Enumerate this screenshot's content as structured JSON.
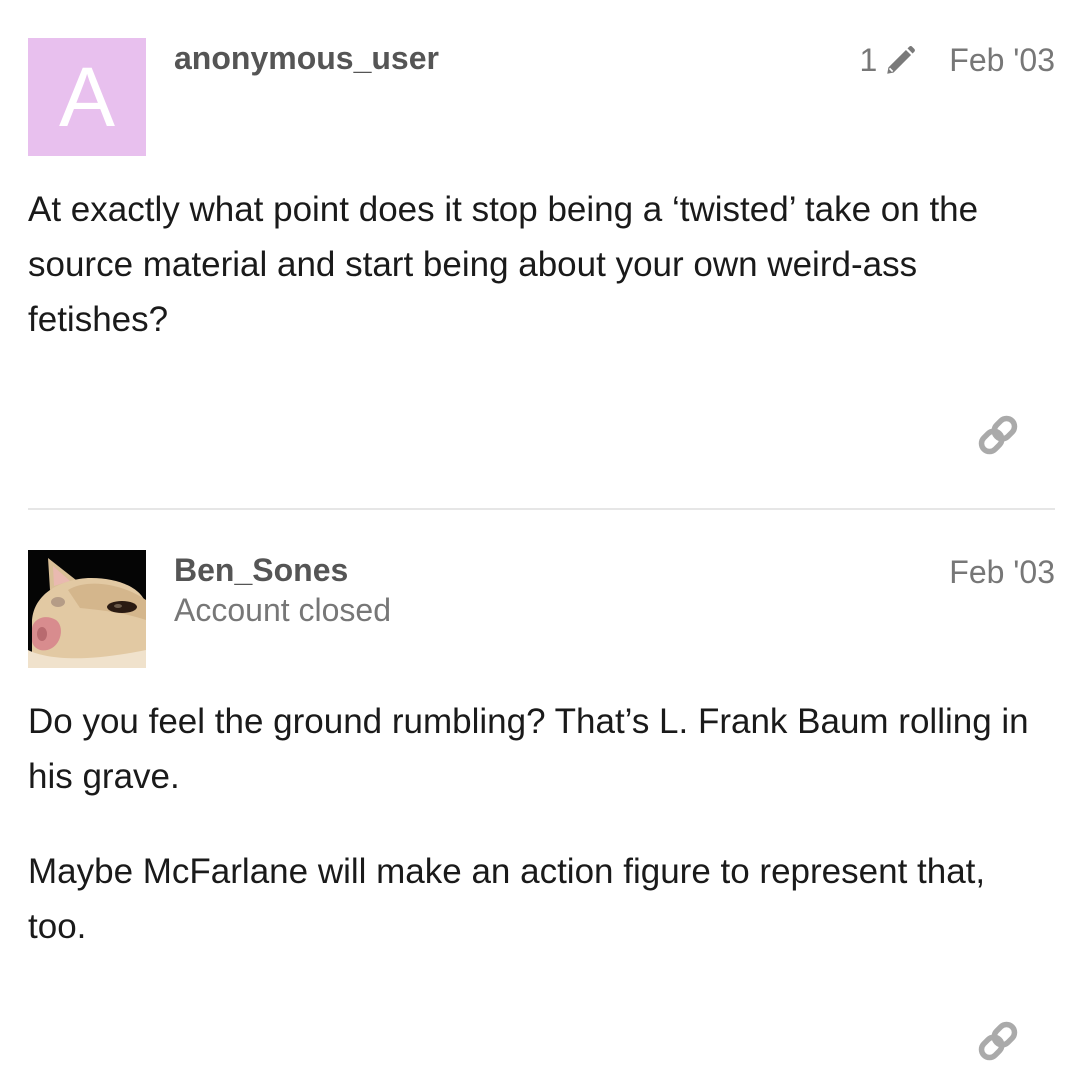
{
  "posts": [
    {
      "username": "anonymous_user",
      "avatar_letter": "A",
      "avatar_color": "#e8c0ee",
      "edit_count": "1",
      "date": "Feb '03",
      "paragraphs": [
        "At exactly what point does it stop being a ‘twisted’ take on the source material and start being about your own weird-ass fetishes?"
      ],
      "icons": {
        "edit": "pencil-icon",
        "share": "link-icon"
      }
    },
    {
      "username": "Ben_Sones",
      "status": "Account closed",
      "date": "Feb '03",
      "paragraphs": [
        "Do you feel the ground rumbling? That’s L. Frank Baum rolling in his grave.",
        "Maybe McFarlane will make an action figure to represent that, too."
      ],
      "icons": {
        "avatar": "cat-avatar",
        "share": "link-icon"
      }
    }
  ],
  "colors": {
    "username": "#555555",
    "meta": "#777777",
    "icon": "#aaaaaa",
    "divider": "#e6e6e6"
  }
}
